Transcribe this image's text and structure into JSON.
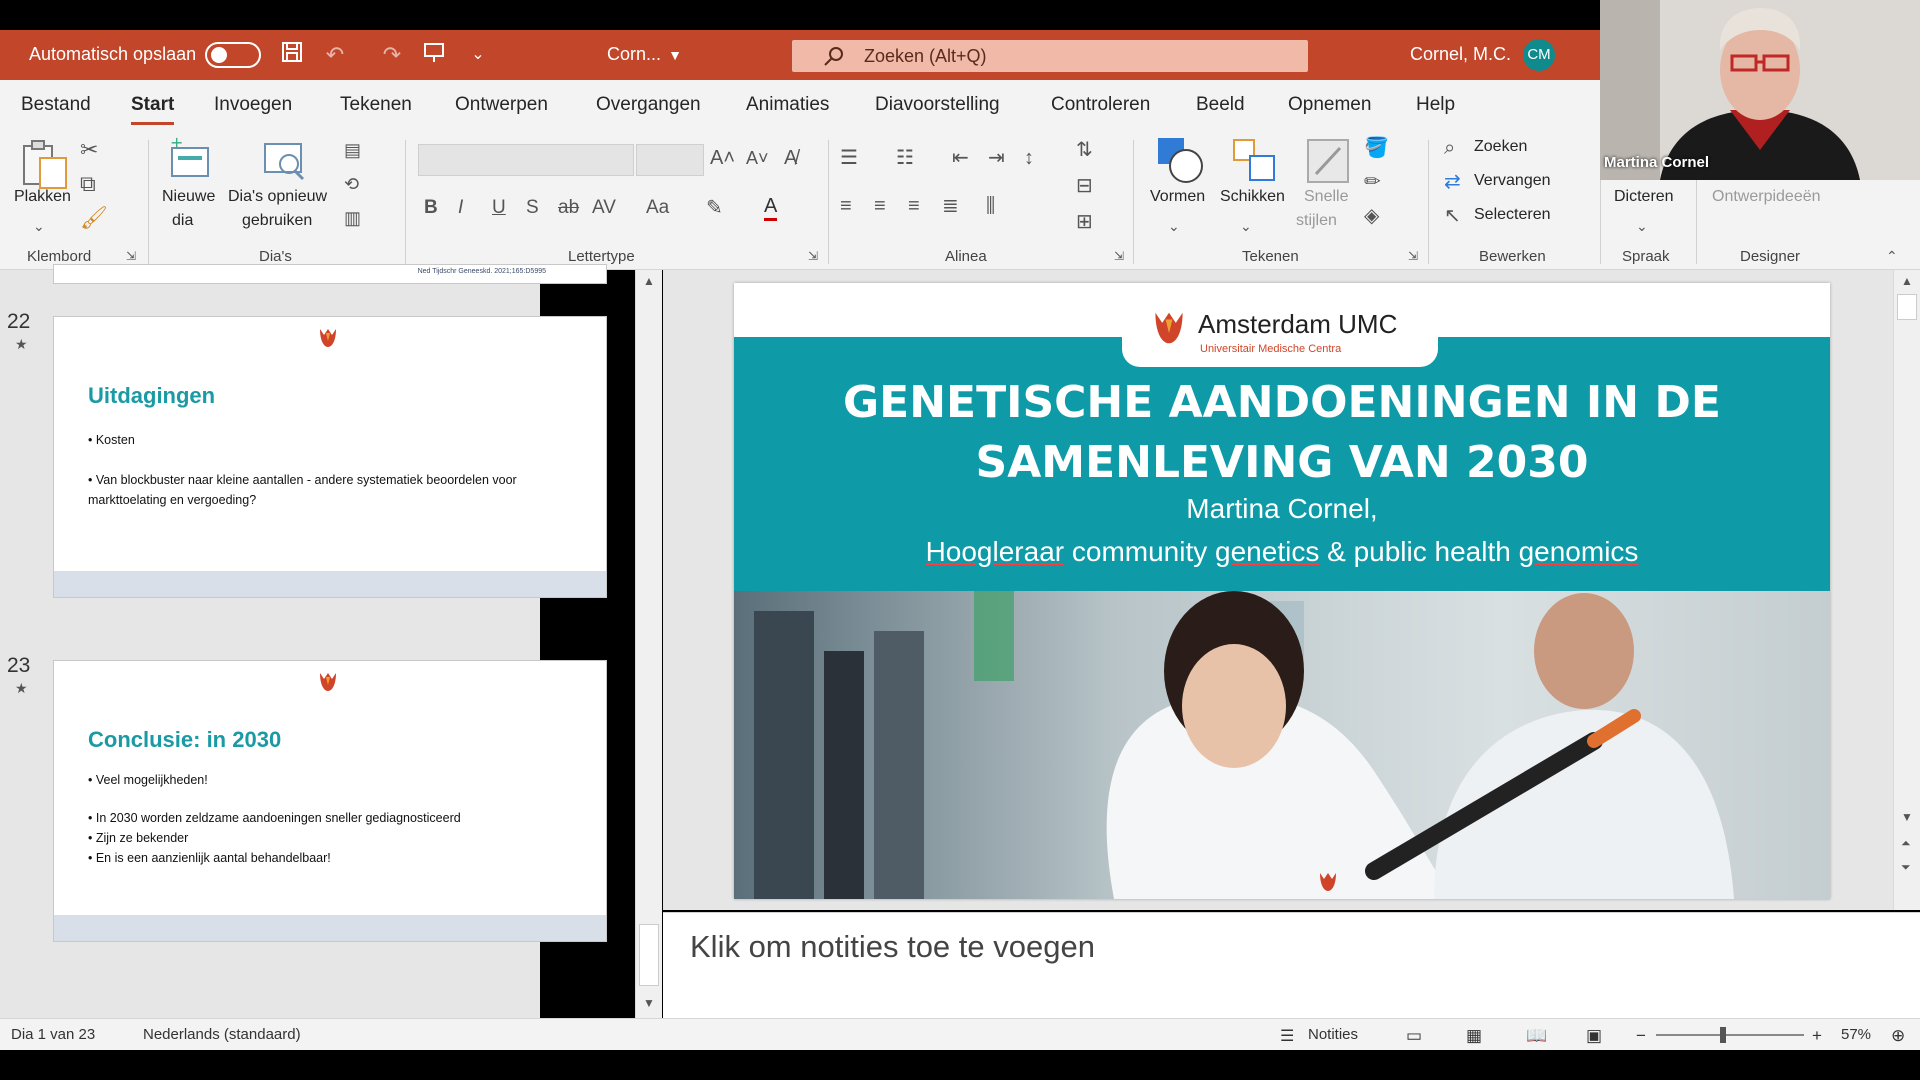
{
  "titlebar": {
    "autosave_label": "Automatisch opslaan",
    "doc_name": "Corn...",
    "search_placeholder": "Zoeken (Alt+Q)",
    "user_name": "Cornel, M.C.",
    "user_initials": "CM"
  },
  "tabs": [
    "Bestand",
    "Start",
    "Invoegen",
    "Tekenen",
    "Ontwerpen",
    "Overgangen",
    "Animaties",
    "Diavoorstelling",
    "Controleren",
    "Beeld",
    "Opnemen",
    "Help"
  ],
  "active_tab": "Start",
  "ribbon": {
    "paste": "Plakken",
    "new_slide_1": "Nieuwe",
    "new_slide_2": "dia",
    "reuse_1": "Dia's opnieuw",
    "reuse_2": "gebruiken",
    "shapes": "Vormen",
    "arrange": "Schikken",
    "quick_styles_1": "Snelle",
    "quick_styles_2": "stijlen",
    "find": "Zoeken",
    "replace": "Vervangen",
    "select": "Selecteren",
    "dictate": "Dicteren",
    "design_ideas": "Ontwerpideeën",
    "groups": {
      "clipboard": "Klembord",
      "slides": "Dia's",
      "font": "Lettertype",
      "paragraph": "Alinea",
      "drawing": "Tekenen",
      "editing": "Bewerken",
      "voice": "Spraak",
      "designer": "Designer"
    }
  },
  "thumbnails": [
    {
      "number": "22",
      "title": "Uitdagingen",
      "bullets": [
        "• Kosten",
        "• Van blockbuster naar kleine aantallen - andere systematiek beoordelen voor",
        "   markttoelating en vergoeding?"
      ]
    },
    {
      "number": "23",
      "title": "Conclusie: in 2030",
      "bullets": [
        "• Veel mogelijkheden!",
        "• In 2030 worden zeldzame aandoeningen sneller gediagnosticeerd",
        "• Zijn ze bekender",
        "• En is een aanzienlijk aantal behandelbaar!"
      ]
    }
  ],
  "prev_thumb_caption": "Ned Tijdschr Geneeskd. 2021;165:D5995",
  "slide": {
    "logo_name": "Amsterdam UMC",
    "logo_sub": "Universitair Medische Centra",
    "title_line1": "GENETISCHE AANDOENINGEN IN DE",
    "title_line2": "SAMENLEVING VAN 2030",
    "author": "Martina Cornel,",
    "subtitle_parts": [
      "Hoogleraar",
      " community ",
      "genetics",
      " & public health ",
      "genomics"
    ]
  },
  "notes_placeholder": "Klik om notities toe te voegen",
  "statusbar": {
    "slide_info": "Dia 1 van 23",
    "language": "Nederlands (standaard)",
    "notes": "Notities",
    "zoom": "57%"
  },
  "zoom_fraction": 0.45,
  "webcam": {
    "name": "Martina Cornel"
  },
  "colors": {
    "accent": "#c2462a",
    "teal": "#0f9aa8"
  }
}
